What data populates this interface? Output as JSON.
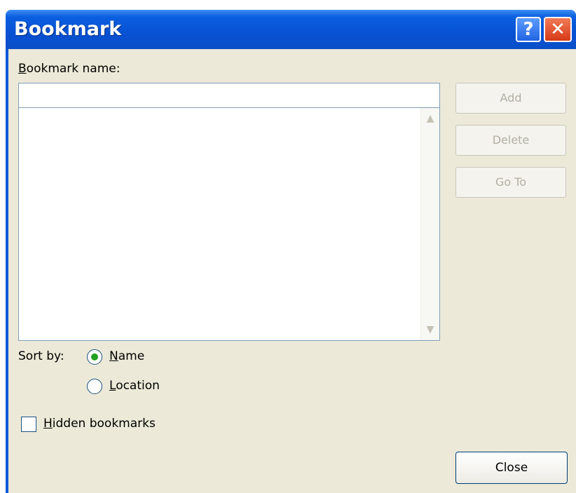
{
  "window": {
    "title": "Bookmark",
    "help_button": "?",
    "close_glyph": "✕"
  },
  "bookmark_name": {
    "label_first": "B",
    "label_rest": "ookmark name:",
    "value": "",
    "placeholder": ""
  },
  "buttons": {
    "add": "Add",
    "delete": "Delete",
    "goto": "Go To",
    "close": "Close"
  },
  "scrollbar": {
    "up_icon": "▲",
    "down_icon": "▼"
  },
  "sort_by": {
    "label": "Sort by:",
    "options": [
      {
        "mnemonic": "N",
        "rest": "ame",
        "selected": true
      },
      {
        "mnemonic": "L",
        "rest": "ocation",
        "selected": false
      }
    ]
  },
  "hidden_bookmarks": {
    "mnemonic": "H",
    "rest": "idden bookmarks",
    "checked": false
  },
  "colors": {
    "title_bar": "#0751d3",
    "dialog_bg": "#ece9d8",
    "radio_dot": "#21a121",
    "close_icon_bg": "#d63a17"
  }
}
